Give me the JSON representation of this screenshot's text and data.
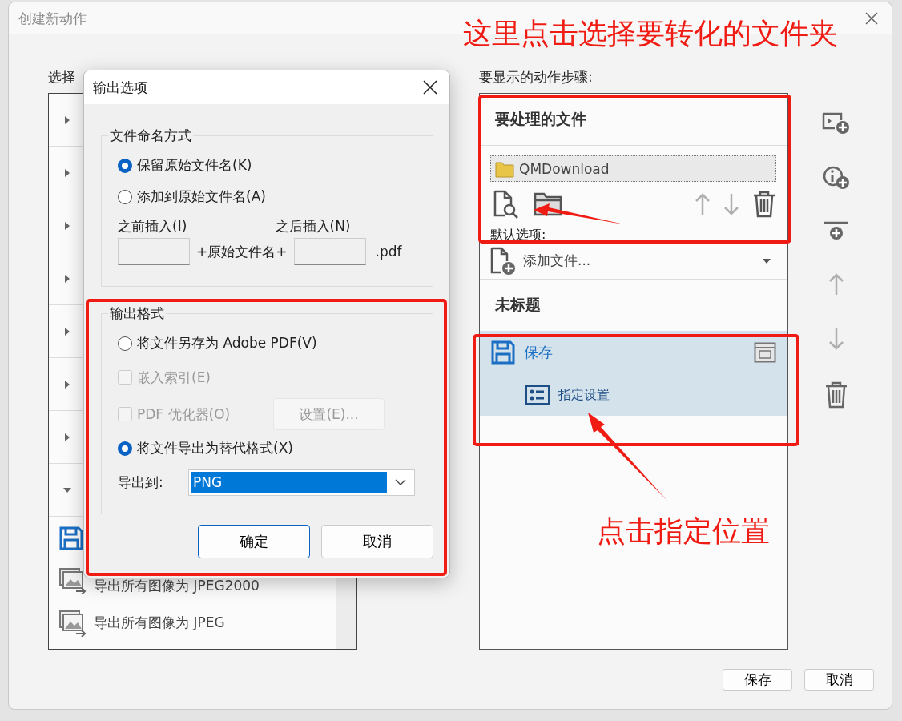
{
  "window": {
    "title": "创建新动作"
  },
  "left_panel": {
    "label": "选择",
    "tree": [
      {
        "expanded": false
      },
      {
        "expanded": false
      },
      {
        "expanded": false
      },
      {
        "expanded": false
      },
      {
        "expanded": false
      },
      {
        "expanded": false
      },
      {
        "expanded": false
      },
      {
        "expanded": true
      }
    ],
    "tools": [
      {
        "kind": "save"
      },
      {
        "kind": "export",
        "label": "导出所有图像为 JPEG2000"
      },
      {
        "kind": "export",
        "label": "导出所有图像为 JPEG"
      }
    ]
  },
  "steps_panel": {
    "label": "要显示的动作步骤:",
    "files_title": "要处理的文件",
    "folder": "QMDownload",
    "file_tools": [
      {
        "kind": "inspect",
        "disabled": false
      },
      {
        "kind": "folder",
        "disabled": false
      },
      {
        "kind": "up",
        "disabled": true
      },
      {
        "kind": "down",
        "disabled": true
      },
      {
        "kind": "delete",
        "disabled": false
      }
    ],
    "default_label": "默认选项:",
    "default_option": "添加文件...",
    "action_title": "未标题",
    "actions": [
      {
        "label": "保存",
        "selected": true,
        "children": [
          {
            "label": "指定设置"
          }
        ]
      }
    ]
  },
  "toolbar": [
    {
      "kind": "add-step",
      "disabled": false
    },
    {
      "kind": "add-info",
      "disabled": false
    },
    {
      "kind": "add-group",
      "disabled": false
    },
    {
      "kind": "up",
      "disabled": true
    },
    {
      "kind": "down",
      "disabled": true
    },
    {
      "kind": "delete",
      "disabled": false
    }
  ],
  "buttons": [
    "保存",
    "取消"
  ],
  "dialog": {
    "title": "输出选项",
    "naming": {
      "title": "文件命名方式",
      "options": [
        {
          "label": "保留原始文件名(K)",
          "selected": true
        },
        {
          "label": "添加到原始文件名(A)",
          "selected": false
        }
      ],
      "before_label": "之前插入(I)",
      "after_label": "之后插入(N)",
      "middle": "+原始文件名+",
      "suffix": ".pdf"
    },
    "format": {
      "title": "输出格式",
      "pdf_option": {
        "label": "将文件另存为 Adobe PDF(V)",
        "selected": false
      },
      "checks": [
        {
          "label": "嵌入索引(E)",
          "checked": false,
          "disabled": true
        },
        {
          "label": "PDF 优化器(O)",
          "checked": false,
          "disabled": true
        }
      ],
      "settings_button": {
        "label": "设置(E)...",
        "disabled": true
      },
      "alt_option": {
        "label": "将文件导出为替代格式(X)",
        "selected": true
      },
      "export_label": "导出到:",
      "export_value": "PNG"
    },
    "buttons": [
      {
        "label": "确定",
        "kind": "primary"
      },
      {
        "label": "取消",
        "kind": "normal"
      }
    ]
  },
  "annotations": [
    {
      "text": "这里点击选择要转化的文件夹"
    },
    {
      "text": "点击指定位置"
    }
  ]
}
